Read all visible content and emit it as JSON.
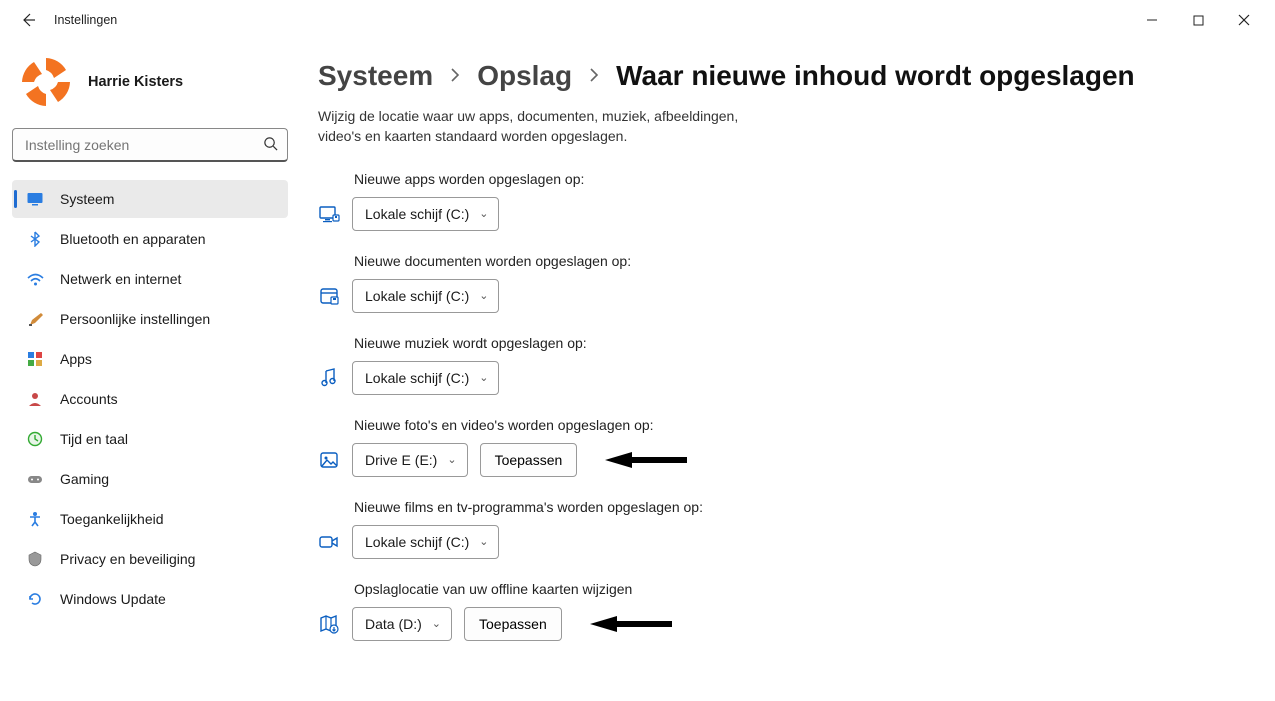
{
  "window": {
    "title": "Instellingen"
  },
  "profile": {
    "name": "Harrie Kisters"
  },
  "search": {
    "placeholder": "Instelling zoeken"
  },
  "sidebar": {
    "items": [
      {
        "label": "Systeem",
        "active": true
      },
      {
        "label": "Bluetooth en apparaten"
      },
      {
        "label": "Netwerk en internet"
      },
      {
        "label": "Persoonlijke instellingen"
      },
      {
        "label": "Apps"
      },
      {
        "label": "Accounts"
      },
      {
        "label": "Tijd en taal"
      },
      {
        "label": "Gaming"
      },
      {
        "label": "Toegankelijkheid"
      },
      {
        "label": "Privacy en beveiliging"
      },
      {
        "label": "Windows Update"
      }
    ]
  },
  "breadcrumb": {
    "level1": "Systeem",
    "level2": "Opslag",
    "current": "Waar nieuwe inhoud wordt opgeslagen"
  },
  "description": "Wijzig de locatie waar uw apps, documenten, muziek, afbeeldingen, video's en kaarten standaard worden opgeslagen.",
  "settings": {
    "apps": {
      "label": "Nieuwe apps worden opgeslagen op:",
      "value": "Lokale schijf (C:)"
    },
    "docs": {
      "label": "Nieuwe documenten worden opgeslagen op:",
      "value": "Lokale schijf (C:)"
    },
    "music": {
      "label": "Nieuwe muziek wordt opgeslagen op:",
      "value": "Lokale schijf (C:)"
    },
    "photos": {
      "label": "Nieuwe foto's en video's worden opgeslagen op:",
      "value": "Drive E (E:)",
      "apply": "Toepassen"
    },
    "films": {
      "label": "Nieuwe films en tv-programma's worden opgeslagen op:",
      "value": "Lokale schijf (C:)"
    },
    "maps": {
      "label": "Opslaglocatie van uw offline kaarten wijzigen",
      "value": "Data (D:)",
      "apply": "Toepassen"
    }
  }
}
